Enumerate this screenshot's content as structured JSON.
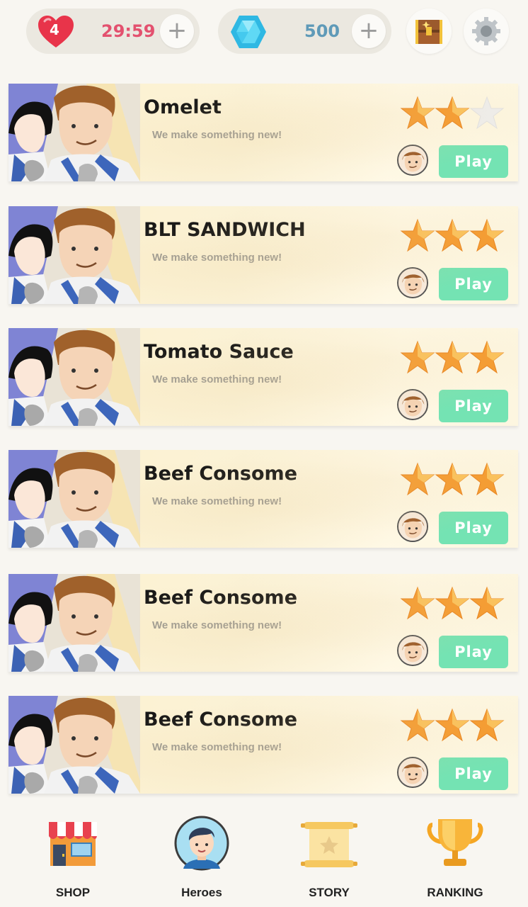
{
  "status": {
    "lives": "4",
    "timer": "29:59",
    "gems": "500",
    "plus": "+"
  },
  "levels": [
    {
      "title": "Omelet",
      "subtitle": "We make something new!",
      "stars": 2,
      "play": "Play"
    },
    {
      "title": "BLT SANDWICH",
      "subtitle": "We make something new!",
      "stars": 3,
      "play": "Play"
    },
    {
      "title": "Tomato Sauce",
      "subtitle": "We make something new!",
      "stars": 3,
      "play": "Play"
    },
    {
      "title": "Beef Consome",
      "subtitle": "We make something new!",
      "stars": 3,
      "play": "Play"
    },
    {
      "title": "Beef Consome",
      "subtitle": "We make something new!",
      "stars": 3,
      "play": "Play"
    },
    {
      "title": "Beef Consome",
      "subtitle": "We make something new!",
      "stars": 3,
      "play": "Play"
    }
  ],
  "nav": [
    {
      "label": "SHOP",
      "icon": "shop-icon"
    },
    {
      "label": "Heroes",
      "icon": "hero-avatar-icon"
    },
    {
      "label": "STORY",
      "icon": "scroll-icon"
    },
    {
      "label": "RANKING",
      "icon": "trophy-icon"
    }
  ],
  "colors": {
    "heart": "#e8344a",
    "timer": "#e3516f",
    "gem": "#3cc8ea",
    "gem_text": "#5f9ab8",
    "play": "#74e3b3",
    "star": "#f59a2e",
    "star_empty": "#eeeeee"
  }
}
